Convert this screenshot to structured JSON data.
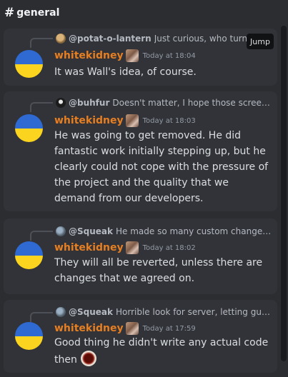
{
  "channel": {
    "hash": "#",
    "name": "general"
  },
  "tooltip": {
    "label": "Jump"
  },
  "messages": [
    {
      "reply_user": "@potat-o-lantern",
      "reply_text": "Just curious, who turned",
      "reply_avatar": "potato-avatar-icon",
      "username": "whitekidney",
      "timestamp": "Today at 18:04",
      "text": "It was Wall's idea, of course."
    },
    {
      "reply_user": "@buhfur",
      "reply_text": "Doesn't matter, I hope those screen…",
      "reply_avatar": "buhfur-avatar-icon",
      "username": "whitekidney",
      "timestamp": "Today at 18:03",
      "text": "He was going to get removed. He did fantastic work initially stepping up, but he clearly could not cope with the pressure of the project and the quality that we demand from our developers."
    },
    {
      "reply_user": "@Squeak",
      "reply_text": "He made so many custom changes…",
      "reply_avatar": "squeak-avatar-icon",
      "username": "whitekidney",
      "timestamp": "Today at 18:02",
      "text": "They will all be reverted, unless there are changes that we agreed on."
    },
    {
      "reply_user": "@Squeak",
      "reply_text": "Horrible look for server, letting guy …",
      "reply_avatar": "squeak-avatar-icon",
      "username": "whitekidney",
      "timestamp": "Today at 17:59",
      "text": "Good thing he didn't write any actual code then",
      "emoji": "eye-emoji-icon"
    }
  ],
  "colors": {
    "background": "#2b2d31",
    "card": "#313338",
    "username": "#e67e22",
    "text": "#dbdee1",
    "muted": "#949ba4",
    "flag_blue": "#2e6ad1",
    "flag_yellow": "#fad41e"
  }
}
